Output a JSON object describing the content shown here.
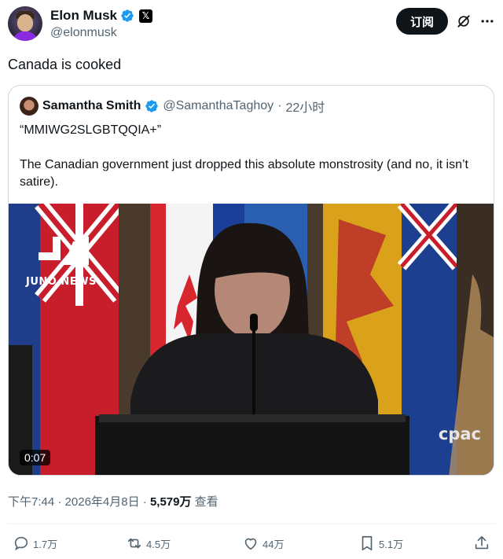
{
  "author": {
    "display_name": "Elon Musk",
    "handle": "@elonmusk",
    "verified_icon": "verified-badge-icon",
    "affiliation_icon": "x-logo-icon",
    "x_badge_glyph": "𝕏"
  },
  "header": {
    "subscribe_label": "订阅",
    "grok_icon": "grok-icon",
    "more_icon": "more-icon"
  },
  "tweet": {
    "text": "Canada is cooked"
  },
  "quote": {
    "display_name": "Samantha Smith",
    "handle": "@SamanthaTaghoy",
    "separator": "·",
    "time_ago": "22小时",
    "text": "“MMIWG2SLGBTQQIA+”\n\nThe Canadian government just dropped this absolute monstrosity (and no, it isn’t satire).",
    "media": {
      "brand_name": "JUNO NEWS",
      "watermark": "cpac",
      "duration": "0:07"
    }
  },
  "meta": {
    "time": "下午7:44",
    "date": "2026年4月8日",
    "separator": "·",
    "views_count": "5,579万",
    "views_label": "查看"
  },
  "actions": {
    "replies": "1.7万",
    "reposts": "4.5万",
    "likes": "44万",
    "bookmarks": "5.1万"
  },
  "colors": {
    "accent": "#1d9bf0",
    "text": "#0f1419",
    "secondary": "#536471",
    "border": "#cfd9de"
  }
}
